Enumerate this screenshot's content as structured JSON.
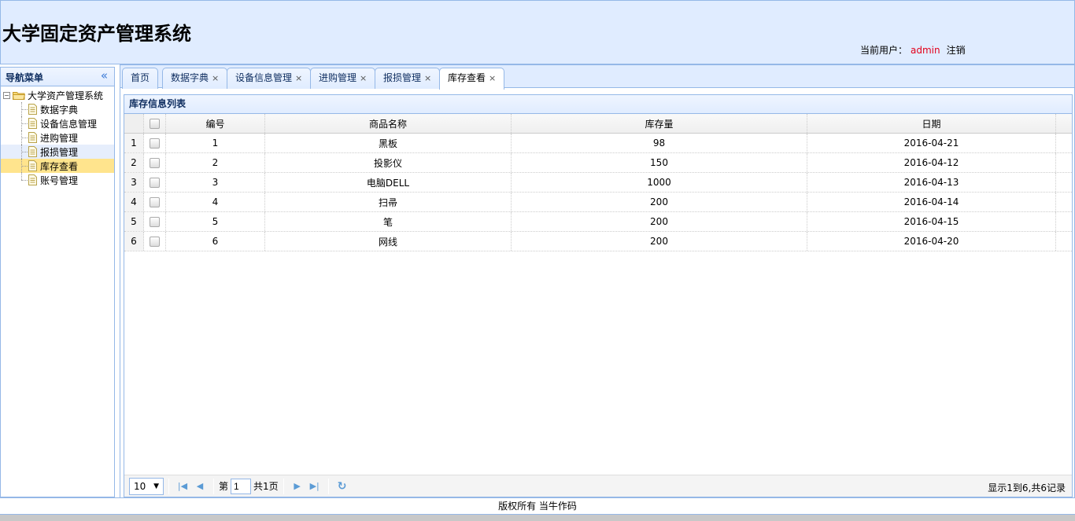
{
  "header": {
    "title": "大学固定资产管理系统",
    "current_user_label": "当前用户：",
    "username": "admin",
    "logout_label": "注销"
  },
  "sidebar": {
    "title": "导航菜单",
    "collapse_icon": "double-chevron-left-icon",
    "root": {
      "label": "大学资产管理系统"
    },
    "items": [
      {
        "label": "数据字典"
      },
      {
        "label": "设备信息管理"
      },
      {
        "label": "进购管理"
      },
      {
        "label": "报损管理"
      },
      {
        "label": "库存查看"
      },
      {
        "label": "账号管理"
      }
    ]
  },
  "tabs": [
    {
      "label": "首页",
      "closable": false
    },
    {
      "label": "数据字典",
      "closable": true
    },
    {
      "label": "设备信息管理",
      "closable": true
    },
    {
      "label": "进购管理",
      "closable": true
    },
    {
      "label": "报损管理",
      "closable": true
    },
    {
      "label": "库存查看",
      "closable": true,
      "active": true
    }
  ],
  "tab_close_glyph": "×",
  "panel": {
    "title": "库存信息列表",
    "columns": {
      "id": "编号",
      "name": "商品名称",
      "qty": "库存量",
      "date": "日期"
    },
    "rows": [
      {
        "rn": "1",
        "id": "1",
        "name": "黑板",
        "qty": "98",
        "date": "2016-04-21"
      },
      {
        "rn": "2",
        "id": "2",
        "name": "投影仪",
        "qty": "150",
        "date": "2016-04-12"
      },
      {
        "rn": "3",
        "id": "3",
        "name": "电脑DELL",
        "qty": "1000",
        "date": "2016-04-13"
      },
      {
        "rn": "4",
        "id": "4",
        "name": "扫帚",
        "qty": "200",
        "date": "2016-04-14"
      },
      {
        "rn": "5",
        "id": "5",
        "name": "笔",
        "qty": "200",
        "date": "2016-04-15"
      },
      {
        "rn": "6",
        "id": "6",
        "name": "网线",
        "qty": "200",
        "date": "2016-04-20"
      }
    ]
  },
  "pager": {
    "page_size": "10",
    "page_prefix": "第",
    "page_value": "1",
    "page_suffix": "共1页",
    "info": "显示1到6,共6记录"
  },
  "footer": {
    "text": "版权所有  当牛作码"
  },
  "colors": {
    "header_bg": "#e0ecff",
    "border": "#95b8e7",
    "selected": "#ffe48d",
    "username": "#e3001b"
  }
}
